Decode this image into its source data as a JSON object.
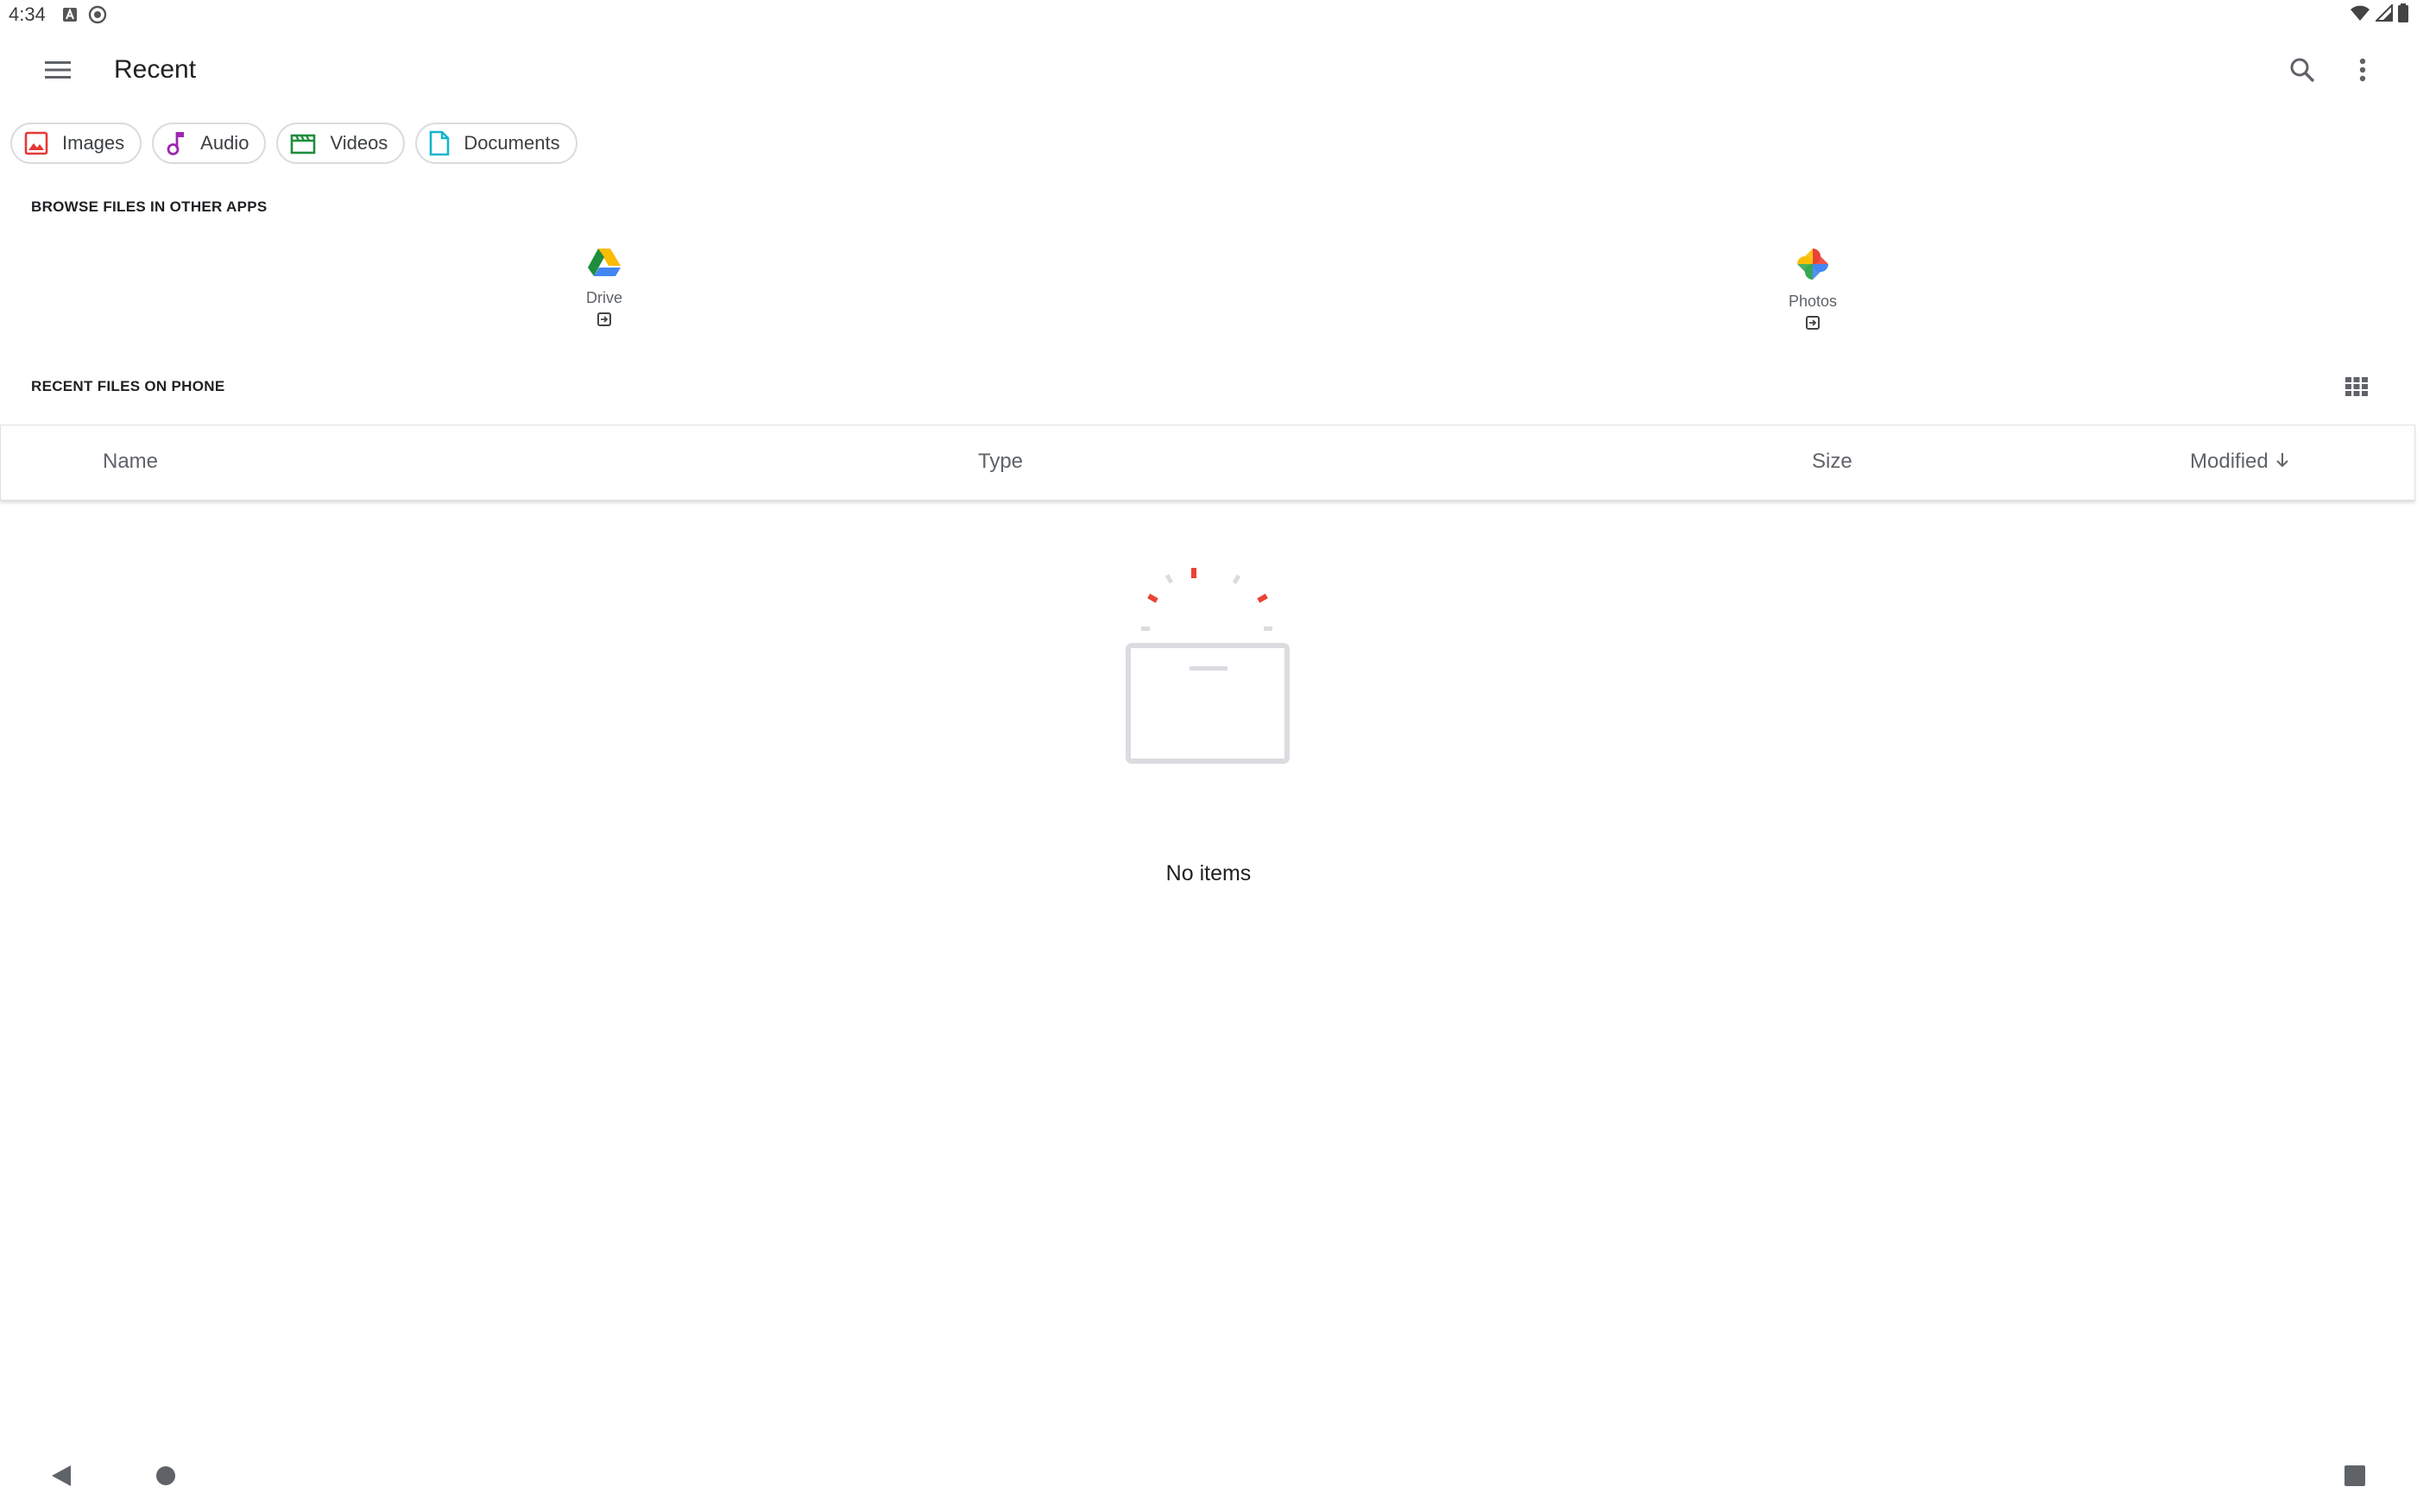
{
  "status_bar": {
    "time": "4:34"
  },
  "toolbar": {
    "title": "Recent"
  },
  "filters": [
    {
      "label": "Images",
      "icon": "image-icon",
      "color": "#e53935"
    },
    {
      "label": "Audio",
      "icon": "music-note-icon",
      "color": "#9c27b0"
    },
    {
      "label": "Videos",
      "icon": "movie-icon",
      "color": "#1e8e3e"
    },
    {
      "label": "Documents",
      "icon": "document-icon",
      "color": "#12b5cb"
    }
  ],
  "browse_section": {
    "heading": "BROWSE FILES IN OTHER APPS",
    "apps": [
      {
        "label": "Drive",
        "icon": "google-drive-icon"
      },
      {
        "label": "Photos",
        "icon": "google-photos-icon"
      }
    ]
  },
  "recent_section": {
    "heading": "RECENT FILES ON PHONE"
  },
  "table": {
    "columns": {
      "name": "Name",
      "type": "Type",
      "size": "Size",
      "modified": "Modified",
      "sort_direction": "descending"
    }
  },
  "empty_state": {
    "text": "No items"
  },
  "colors": {
    "accent_red": "#ea4335",
    "icon_gray": "#5f6368"
  }
}
